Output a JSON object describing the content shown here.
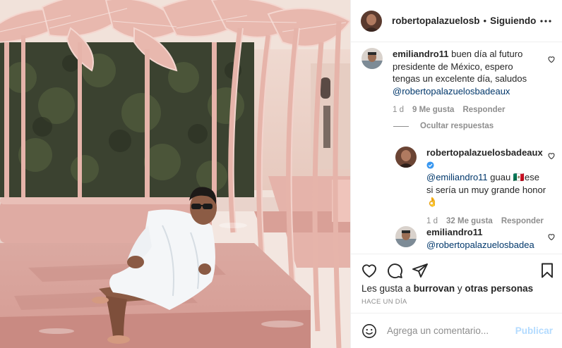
{
  "post": {
    "author": "robertopalazuelosb",
    "separator": "•",
    "follow_status": "Siguiendo",
    "more_icon": "more-horizontal-icon"
  },
  "comments": [
    {
      "user": "emiliandro11",
      "text": "buen día al futuro presidente de México, espero tengas un excelente día, saludos ",
      "mention": "@robertopalazuelosbadeaux",
      "time": "1 d",
      "likes": "9 Me gusta",
      "reply": "Responder"
    }
  ],
  "hide_replies": "Ocultar respuestas",
  "replies": [
    {
      "user": "robertopalazuelosbadeaux",
      "verified_icon": "verified-badge-icon",
      "mention": "@emiliandro11",
      "text_a": " guau ",
      "flag": "🇲🇽",
      "text_b": "ese si sería un muy grande honor ",
      "emoji": "👌",
      "time": "1 d",
      "likes": "32 Me gusta",
      "reply": "Responder"
    },
    {
      "user": "emiliandro11",
      "mention": "@robertopalazuelosbadea"
    }
  ],
  "actions": {
    "like_icon": "heart-icon",
    "comment_icon": "comment-icon",
    "share_icon": "paper-plane-icon",
    "save_icon": "bookmark-icon"
  },
  "likes": {
    "prefix": "Les gusta a ",
    "user": "burrovan",
    "middle": " y ",
    "others": "otras personas"
  },
  "time_ago": "HACE UN DÍA",
  "add_comment": {
    "emoji_icon": "smiley-icon",
    "placeholder": "Agrega un comentario...",
    "publish": "Publicar"
  },
  "colors": {
    "pink": "#e8b8ae",
    "link_blue": "#00376b",
    "publish_disabled": "#b3dbff",
    "muted": "#8e8e8e"
  }
}
